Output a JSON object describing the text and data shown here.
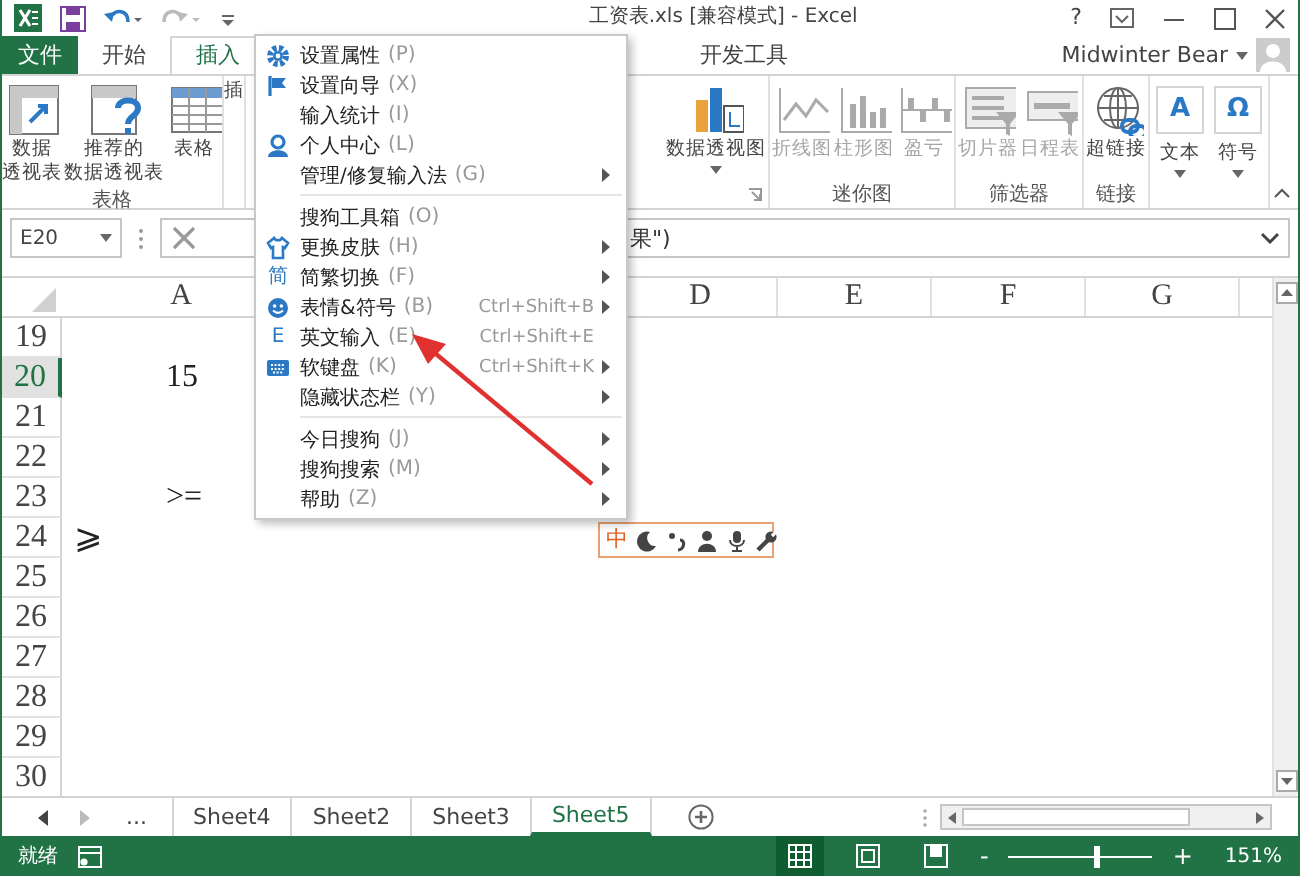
{
  "title_bar": {
    "title": "工资表.xls  [兼容模式] - Excel",
    "help": "?"
  },
  "tabs": [
    {
      "label": "文件",
      "kind": "file",
      "selected": false
    },
    {
      "label": "开始",
      "kind": "tab",
      "selected": false
    },
    {
      "label": "插入",
      "kind": "tab",
      "selected": true
    },
    {
      "label": "开发工具",
      "kind": "tab",
      "selected": false
    }
  ],
  "user": {
    "name": "Midwinter Bear"
  },
  "ribbon": {
    "left_groups": [
      {
        "label": "表格",
        "items": [
          {
            "lines": [
              "数据",
              "透视表"
            ],
            "kind": "pivot",
            "disabled": false,
            "caret": false
          },
          {
            "lines": [
              "推荐的",
              "数据透视表"
            ],
            "kind": "recommend",
            "disabled": false,
            "caret": false
          },
          {
            "lines": [
              "表格"
            ],
            "kind": "table",
            "disabled": false,
            "caret": false
          }
        ]
      },
      {
        "items": [
          {
            "lines": [
              "插"
            ],
            "kind": "plain",
            "disabled": false,
            "caret": false
          }
        ]
      }
    ],
    "right_groups": [
      {
        "launcher": true,
        "items": [
          {
            "lines": [
              "数据透视图"
            ],
            "kind": "pivotchart",
            "disabled": false,
            "caret": true
          }
        ]
      },
      {
        "label": "迷你图",
        "items": [
          {
            "lines": [
              "折线图"
            ],
            "kind": "line",
            "disabled": true,
            "caret": false
          },
          {
            "lines": [
              "柱形图"
            ],
            "kind": "column",
            "disabled": true,
            "caret": false
          },
          {
            "lines": [
              "盈亏"
            ],
            "kind": "winloss",
            "disabled": true,
            "caret": false
          }
        ]
      },
      {
        "label": "筛选器",
        "items": [
          {
            "lines": [
              "切片器"
            ],
            "kind": "slicer",
            "disabled": true,
            "caret": false
          },
          {
            "lines": [
              "日程表"
            ],
            "kind": "timeline",
            "disabled": true,
            "caret": false
          }
        ]
      },
      {
        "label": "链接",
        "items": [
          {
            "lines": [
              "超链接"
            ],
            "kind": "link",
            "disabled": false,
            "caret": false
          }
        ]
      },
      {
        "items": [
          {
            "lines": [
              "文本"
            ],
            "kind": "glyph",
            "glyph": "A",
            "disabled": false,
            "caret": true
          },
          {
            "lines": [
              "符号"
            ],
            "kind": "glyph",
            "glyph": "Ω",
            "disabled": false,
            "caret": true
          }
        ]
      }
    ]
  },
  "formula_bar": {
    "name_box": "E20",
    "formula": "果\")"
  },
  "columns": [
    {
      "label": "A",
      "kind": "wide"
    },
    {
      "label": "D",
      "kind": "normal"
    },
    {
      "label": "E",
      "kind": "normal"
    },
    {
      "label": "F",
      "kind": "normal"
    },
    {
      "label": "G",
      "kind": "normal"
    }
  ],
  "rows": [
    {
      "number": "19",
      "selected": false
    },
    {
      "number": "20",
      "selected": true,
      "column_a": {
        "text": "15",
        "kind": "centered"
      }
    },
    {
      "number": "21",
      "selected": false
    },
    {
      "number": "22",
      "selected": false
    },
    {
      "number": "23",
      "selected": false,
      "column_a": {
        "text": ">=",
        "kind": "centered"
      }
    },
    {
      "number": "24",
      "selected": false,
      "column_a": {
        "text": "⩾",
        "kind": "left"
      }
    },
    {
      "number": "25",
      "selected": false
    },
    {
      "number": "26",
      "selected": false
    },
    {
      "number": "27",
      "selected": false
    },
    {
      "number": "28",
      "selected": false
    },
    {
      "number": "29",
      "selected": false
    },
    {
      "number": "30",
      "selected": false
    }
  ],
  "context_menu": {
    "sections": [
      [
        {
          "label": "设置属性",
          "key": "(P)",
          "kind": "gear",
          "submenu": false
        },
        {
          "label": "设置向导",
          "key": "(X)",
          "kind": "flag",
          "submenu": false
        },
        {
          "label": "输入统计",
          "key": "(I)",
          "kind": "plain",
          "submenu": false
        },
        {
          "label": "个人中心",
          "key": "(L)",
          "kind": "person",
          "submenu": false
        },
        {
          "label": "管理/修复输入法",
          "key": "(G)",
          "kind": "plain",
          "submenu": true
        }
      ],
      [
        {
          "label": "搜狗工具箱",
          "key": "(O)",
          "kind": "plain",
          "submenu": false
        },
        {
          "label": "更换皮肤",
          "key": "(H)",
          "kind": "shirt",
          "submenu": true
        },
        {
          "label": "简繁切换",
          "key": "(F)",
          "kind": "glyph",
          "glyph": "简",
          "submenu": true
        },
        {
          "label": "表情&符号",
          "key": "(B)",
          "kind": "smiley",
          "shortcut": "Ctrl+Shift+B",
          "submenu": true
        },
        {
          "label": "英文输入",
          "key": "(E)",
          "kind": "glyph",
          "glyph": "E",
          "shortcut": "Ctrl+Shift+E",
          "submenu": false
        },
        {
          "label": "软键盘",
          "key": "(K)",
          "kind": "keyboard",
          "shortcut": "Ctrl+Shift+K",
          "submenu": true
        },
        {
          "label": "隐藏状态栏",
          "key": "(Y)",
          "kind": "plain",
          "submenu": true
        }
      ],
      [
        {
          "label": "今日搜狗",
          "key": "(J)",
          "kind": "plain",
          "submenu": true
        },
        {
          "label": "搜狗搜索",
          "key": "(M)",
          "kind": "plain",
          "submenu": true
        },
        {
          "label": "帮助",
          "key": "(Z)",
          "kind": "plain",
          "submenu": true
        }
      ]
    ]
  },
  "ime_toolbar": {
    "mode": "中"
  },
  "annotation": {
    "kind": "arrow"
  },
  "sheet_tabs": {
    "more": "...",
    "tabs": [
      {
        "label": "Sheet4",
        "selected": false
      },
      {
        "label": "Sheet2",
        "selected": false
      },
      {
        "label": "Sheet3",
        "selected": false
      },
      {
        "label": "Sheet5",
        "selected": true
      }
    ]
  },
  "status_bar": {
    "ready": "就绪",
    "views": [
      {
        "kind": "normal",
        "selected": true
      },
      {
        "kind": "layout",
        "selected": false
      },
      {
        "kind": "break",
        "selected": false
      }
    ],
    "zoom_minus": "-",
    "zoom_plus": "+",
    "zoom_slider": {
      "level": 0.6
    },
    "zoom": "151%"
  }
}
